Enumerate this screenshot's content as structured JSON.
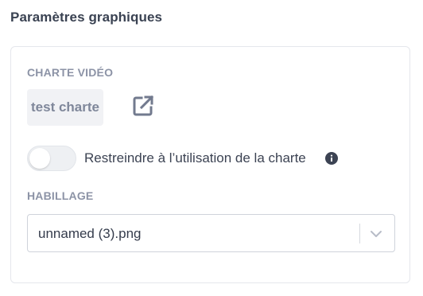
{
  "section": {
    "title": "Paramètres graphiques"
  },
  "charte": {
    "label": "CHARTE VIDÉO",
    "value": "test charte",
    "open_icon": "open-external-icon"
  },
  "restrict": {
    "label": "Restreindre à l’utilisation de la charte",
    "enabled": false,
    "info_icon": "info-icon"
  },
  "habillage": {
    "label": "HABILLAGE",
    "selected": "unnamed (3).png",
    "dropdown_icon": "chevron-down-icon"
  },
  "colors": {
    "title": "#3a4252",
    "label": "#8c93a6",
    "text": "#3c4353",
    "icon": "#727a8e"
  }
}
